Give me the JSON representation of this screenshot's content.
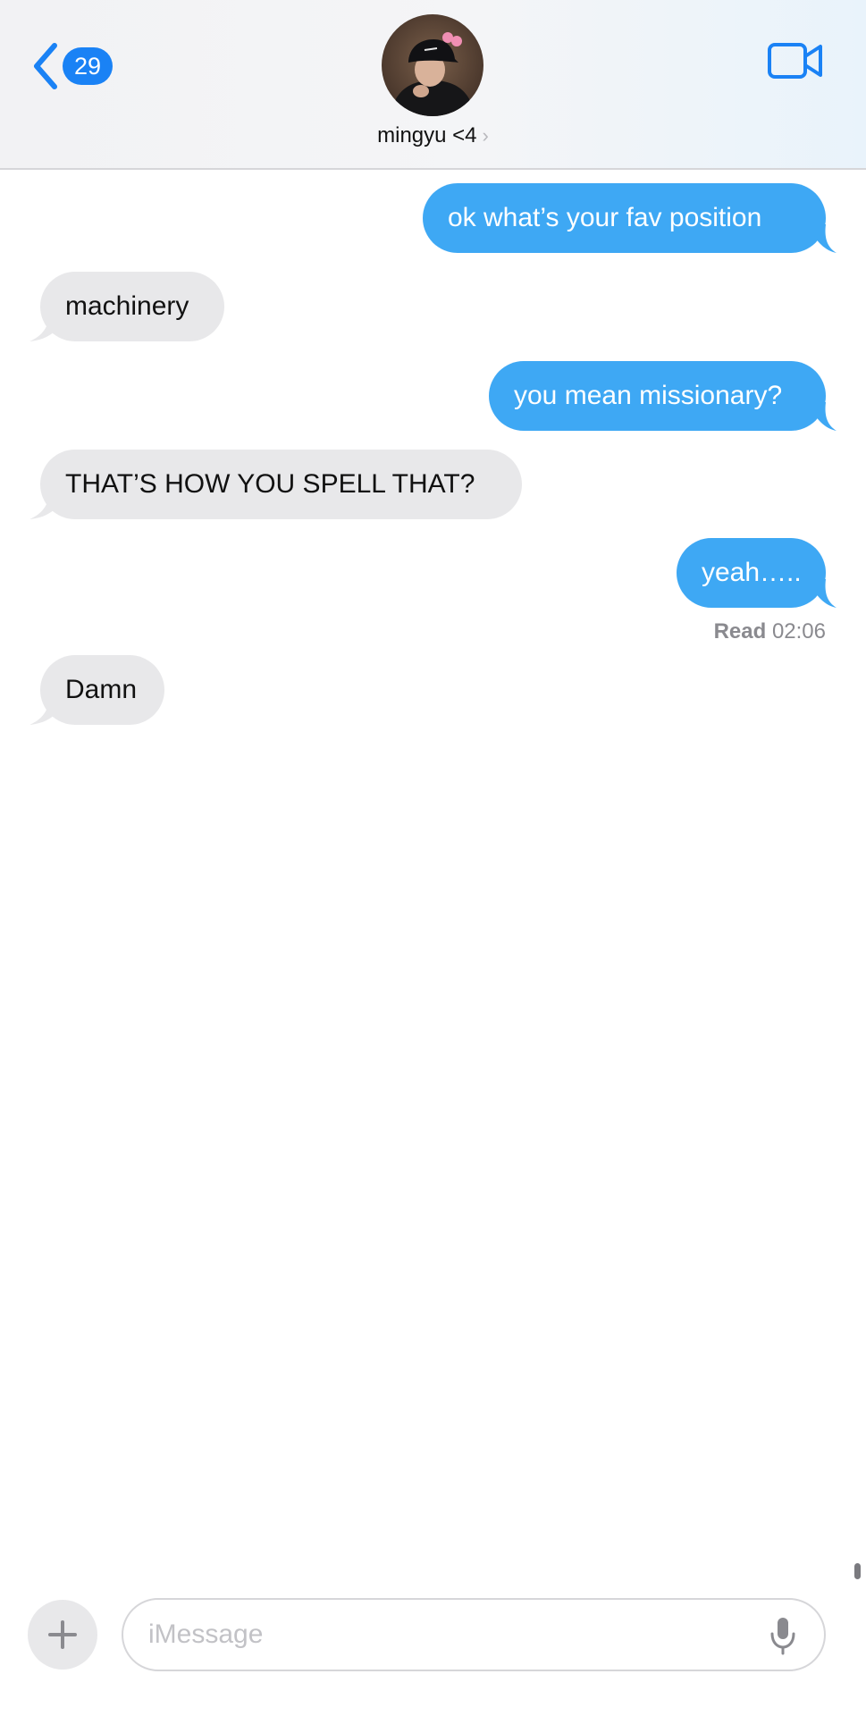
{
  "header": {
    "back_badge_count": "29",
    "contact_name": "mingyu <4",
    "contact_chevron": "›",
    "icons": {
      "back": "chevron-left-icon",
      "video": "video-camera-icon"
    },
    "accent_color": "#1a82f5"
  },
  "messages": [
    {
      "from": "me",
      "text": "ok what’s your fav position"
    },
    {
      "from": "them",
      "text": "machinery"
    },
    {
      "from": "me",
      "text": "you mean missionary?"
    },
    {
      "from": "them",
      "text": "THAT’S HOW YOU SPELL THAT?"
    },
    {
      "from": "me",
      "text": "yeah….."
    },
    {
      "from": "them",
      "text": "Damn"
    }
  ],
  "read_receipt": {
    "label": "Read",
    "time": "02:06"
  },
  "composer": {
    "placeholder": "iMessage",
    "plus_icon": "plus-icon",
    "mic_icon": "microphone-icon"
  },
  "colors": {
    "sent_bubble": "#3ea8f4",
    "received_bubble": "#e8e8ea"
  }
}
